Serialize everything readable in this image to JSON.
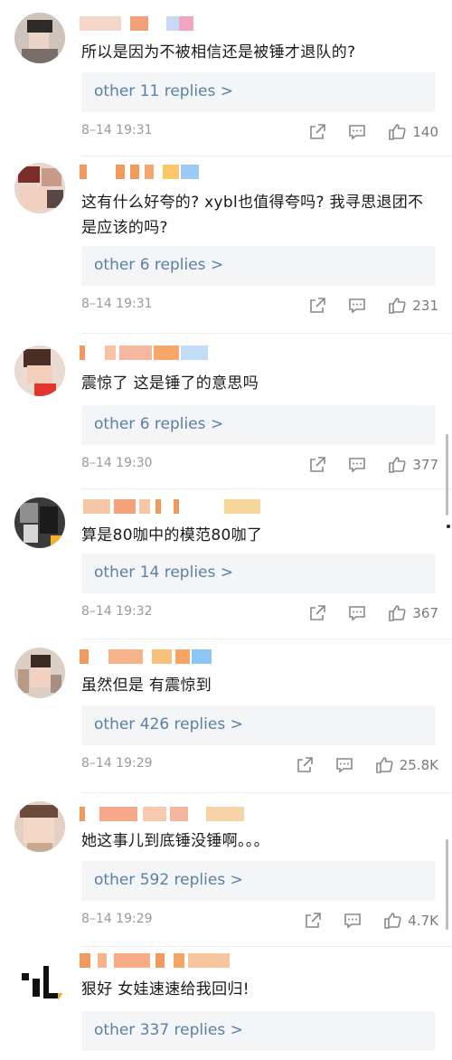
{
  "comments": [
    {
      "text": "所以是因为不被相信还是被锤才退队的?",
      "replies": "other 11 replies >",
      "time": "8–14 19:31",
      "likes": "140"
    },
    {
      "text": "这有什么好夸的? xybl也值得夸吗? 我寻思退团不是应该的吗?",
      "replies": "other 6 replies >",
      "time": "8–14 19:31",
      "likes": "231"
    },
    {
      "text": "震惊了 这是锤了的意思吗",
      "replies": "other 6 replies >",
      "time": "8–14 19:30",
      "likes": "377"
    },
    {
      "text": "算是80咖中的模范80咖了",
      "replies": "other 14 replies >",
      "time": "8–14 19:32",
      "likes": "367"
    },
    {
      "text": "虽然但是 有震惊到",
      "replies": "other 426 replies >",
      "time": "8–14 19:29",
      "likes": "25.8K"
    },
    {
      "text": "她这事儿到底锤没锤啊。。。",
      "replies": "other 592 replies >",
      "time": "8–14 19:29",
      "likes": "4.7K"
    },
    {
      "text": "狠好 女娃速速给我回归!",
      "replies": "other 337 replies >",
      "time": "",
      "likes": ""
    }
  ],
  "icons": {
    "share": "share-external-icon",
    "comment": "comment-bubble-icon",
    "like": "thumbs-up-icon"
  },
  "colors": {
    "reply_link": "#5b7fa6",
    "reply_bg": "#f4f5f7",
    "meta": "#9a9a9a",
    "text": "#1a1a1a"
  }
}
